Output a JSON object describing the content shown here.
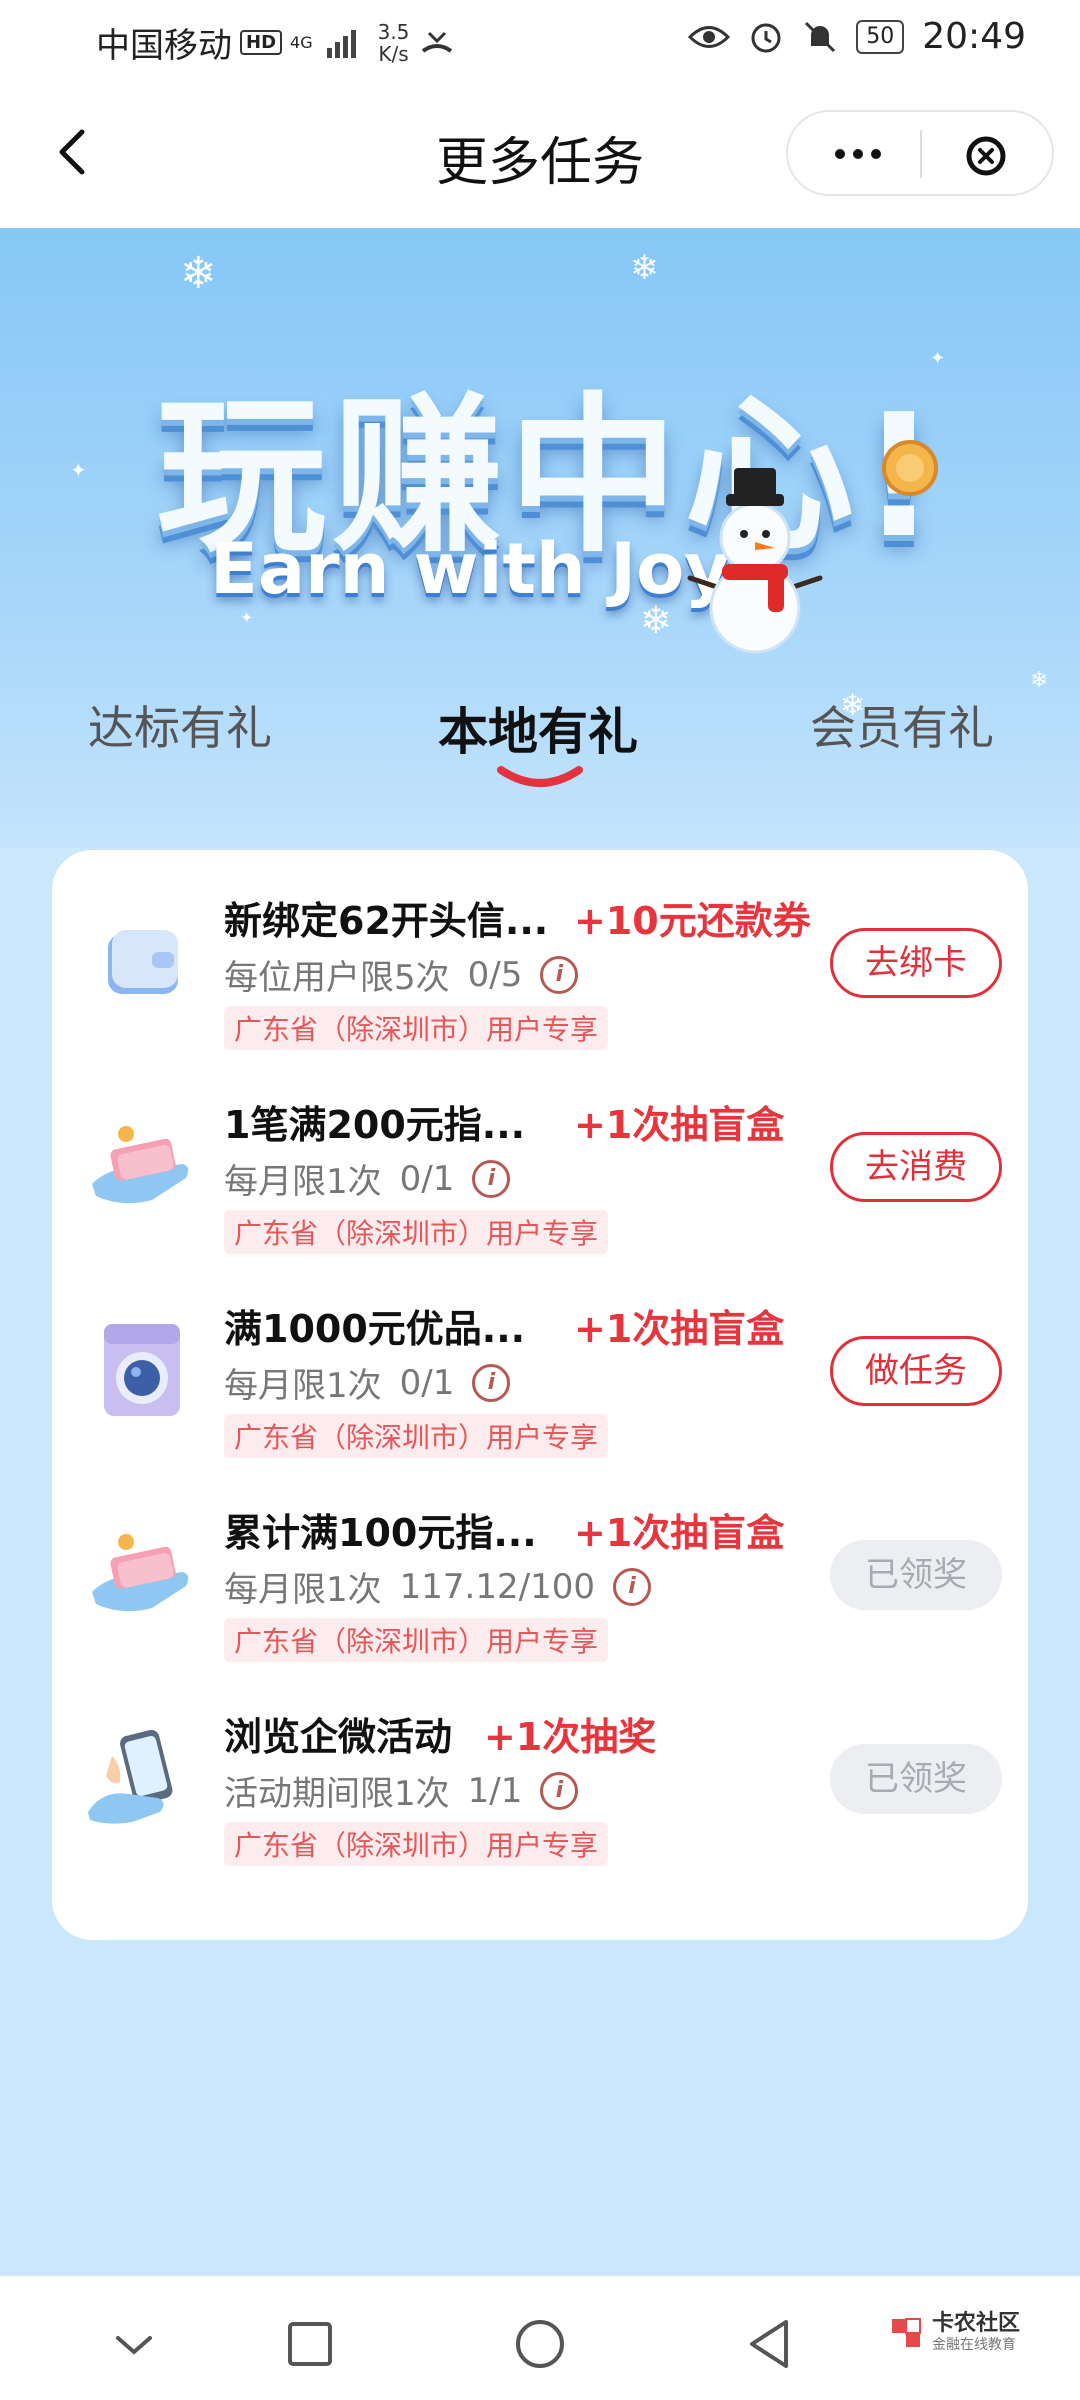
{
  "status_bar": {
    "carrier": "中国移动",
    "network_badge": "HD",
    "network_type": "4G",
    "speed_value": "3.5",
    "speed_unit": "K/s",
    "battery": "50",
    "time": "20:49"
  },
  "nav": {
    "title": "更多任务"
  },
  "hero": {
    "title": "玩赚中心!",
    "subtitle": "Earn with Joy"
  },
  "tabs": [
    {
      "label": "达标有礼",
      "active": false
    },
    {
      "label": "本地有礼",
      "active": true
    },
    {
      "label": "会员有礼",
      "active": false
    }
  ],
  "tasks": [
    {
      "icon": "wallet-icon",
      "title": "新绑定62开头信...",
      "reward": "+10元还款券",
      "limit": "每位用户限5次",
      "progress": "0/5",
      "tag": "广东省（除深圳市）用户专享",
      "button": "去绑卡",
      "state": "primary"
    },
    {
      "icon": "cash-hand-icon",
      "title": "1笔满200元指...",
      "reward": "+1次抽盲盒",
      "limit": "每月限1次",
      "progress": "0/1",
      "tag": "广东省（除深圳市）用户专享",
      "button": "去消费",
      "state": "primary"
    },
    {
      "icon": "washing-machine-icon",
      "title": "满1000元优品...",
      "reward": "+1次抽盲盒",
      "limit": "每月限1次",
      "progress": "0/1",
      "tag": "广东省（除深圳市）用户专享",
      "button": "做任务",
      "state": "primary"
    },
    {
      "icon": "cash-hand-icon",
      "title": "累计满100元指...",
      "reward": "+1次抽盲盒",
      "limit": "每月限1次",
      "progress": "117.12/100",
      "tag": "广东省（除深圳市）用户专享",
      "button": "已领奖",
      "state": "done"
    },
    {
      "icon": "phone-hand-icon",
      "title": "浏览企微活动",
      "reward": "+1次抽奖",
      "limit": "活动期间限1次",
      "progress": "1/1",
      "tag": "广东省（除深圳市）用户专享",
      "button": "已领奖",
      "state": "done"
    }
  ],
  "watermark": {
    "name": "卡农社区",
    "sub": "金融在线教育"
  },
  "colors": {
    "accent_red": "#e0303a",
    "hero_blue": "#86c7f6",
    "page_bg": "#cbe7fb"
  }
}
